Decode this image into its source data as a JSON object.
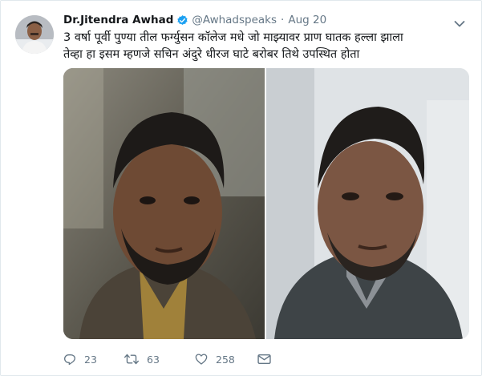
{
  "tweet": {
    "display_name": "Dr.Jitendra Awhad",
    "handle": "@Awhadspeaks",
    "separator": "·",
    "timestamp": "Aug 20",
    "text": "3 वर्षा पूर्वी पुण्या तील फर्ग्युसन कॉलेज मधे जो माझ्यावर प्राण घातक हल्ला झाला तेव्हा हा इसम म्हणजे सचिन अंदुरे  धीरज घाटे बरोबर तिथे उपस्थित होता",
    "verified": true
  },
  "actions": {
    "reply_count": "23",
    "retweet_count": "63",
    "like_count": "258"
  },
  "icons": {
    "verified": "verified-badge-icon",
    "caret": "chevron-down-icon",
    "reply": "reply-icon",
    "retweet": "retweet-icon",
    "like": "heart-icon",
    "message": "direct-message-icon"
  },
  "colors": {
    "verified_blue": "#1da1f2",
    "secondary_text": "#657786",
    "primary_text": "#14171a"
  }
}
